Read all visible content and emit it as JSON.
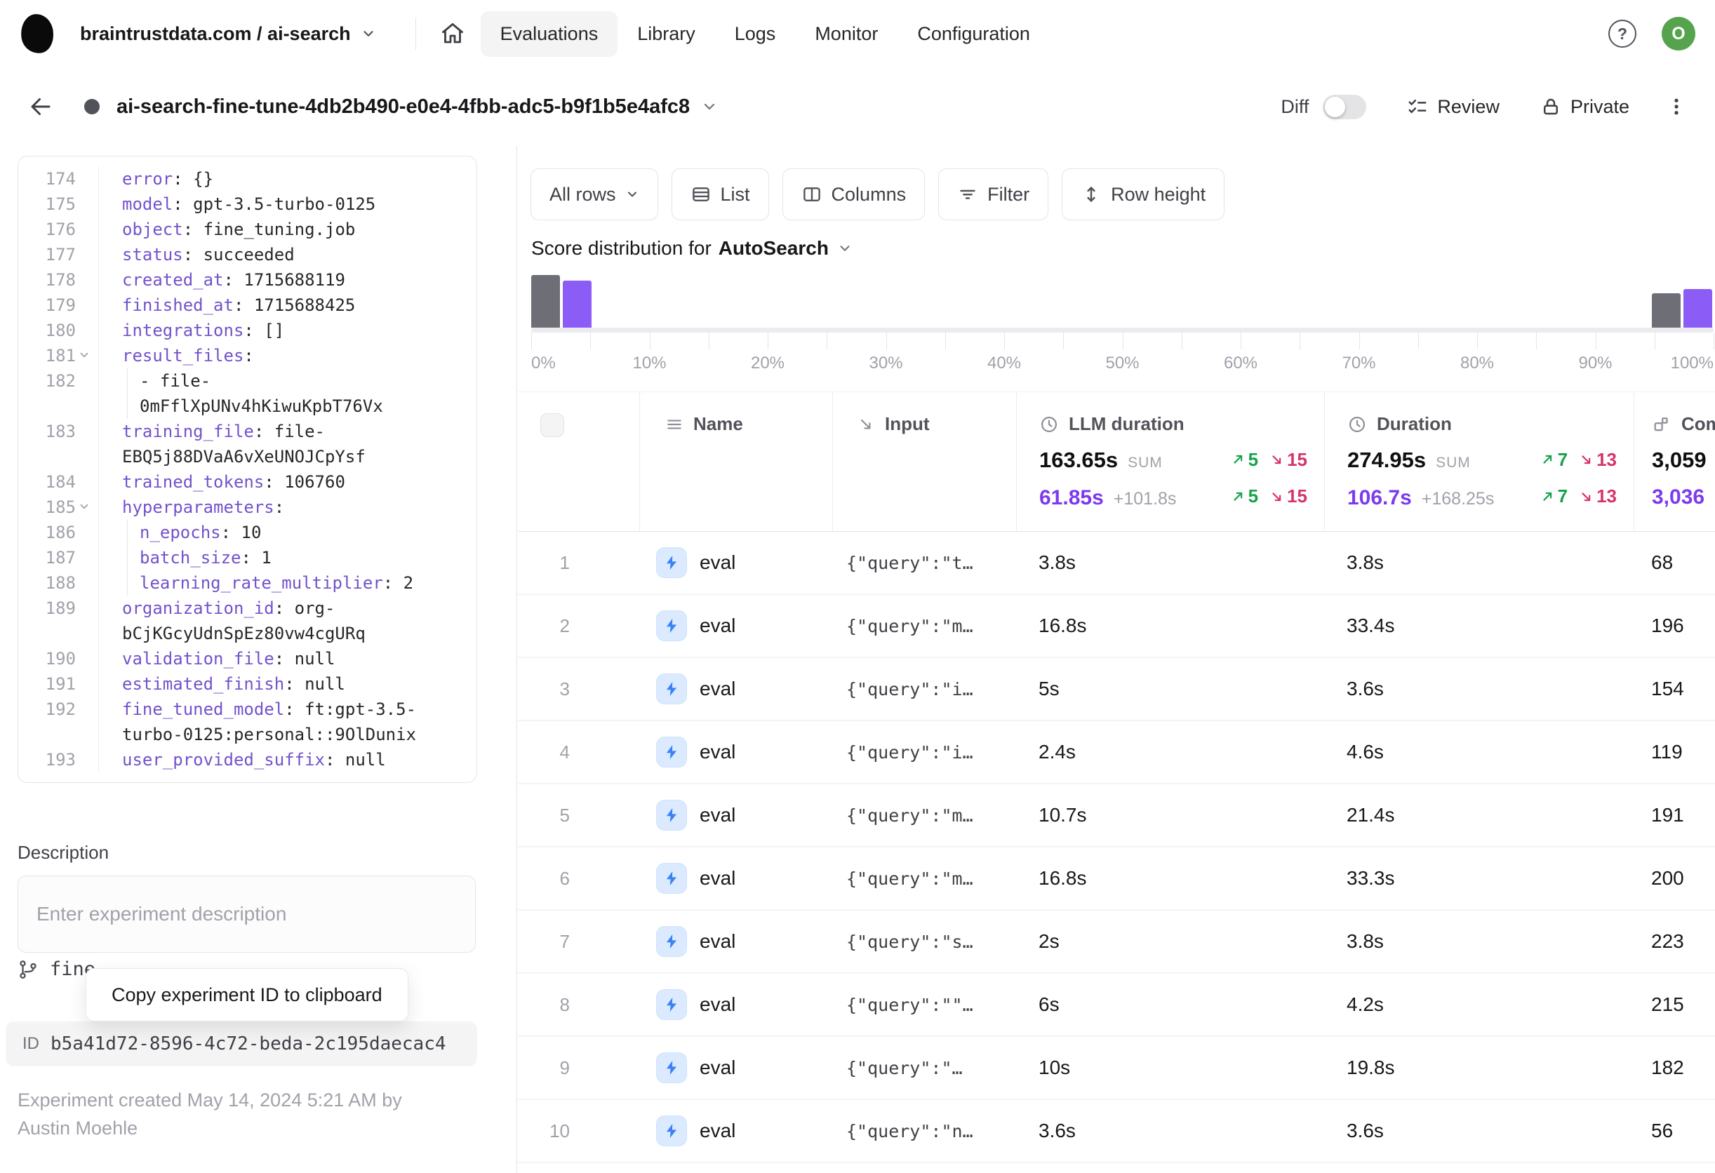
{
  "nav": {
    "breadcrumb": "braintrustdata.com / ai-search",
    "tabs": [
      {
        "label": "Evaluations",
        "active": true
      },
      {
        "label": "Library",
        "active": false
      },
      {
        "label": "Logs",
        "active": false
      },
      {
        "label": "Monitor",
        "active": false
      },
      {
        "label": "Configuration",
        "active": false
      }
    ],
    "avatar_letter": "O"
  },
  "titlebar": {
    "title": "ai-search-fine-tune-4db2b490-e0e4-4fbb-adc5-b9f1b5e4afc8",
    "diff_label": "Diff",
    "review_label": "Review",
    "private_label": "Private"
  },
  "code_panel": {
    "lines": [
      {
        "num": "174",
        "segs": [
          {
            "c": "key",
            "t": "error"
          },
          {
            "c": "t",
            "t": ": {}"
          }
        ]
      },
      {
        "num": "175",
        "segs": [
          {
            "c": "key",
            "t": "model"
          },
          {
            "c": "t",
            "t": ": gpt-3.5-turbo-0125"
          }
        ]
      },
      {
        "num": "176",
        "segs": [
          {
            "c": "key",
            "t": "object"
          },
          {
            "c": "t",
            "t": ": fine_tuning.job"
          }
        ]
      },
      {
        "num": "177",
        "segs": [
          {
            "c": "key",
            "t": "status"
          },
          {
            "c": "t",
            "t": ": succeeded"
          }
        ]
      },
      {
        "num": "178",
        "segs": [
          {
            "c": "key",
            "t": "created_at"
          },
          {
            "c": "t",
            "t": ": 1715688119"
          }
        ]
      },
      {
        "num": "179",
        "segs": [
          {
            "c": "key",
            "t": "finished_at"
          },
          {
            "c": "t",
            "t": ": 1715688425"
          }
        ]
      },
      {
        "num": "180",
        "segs": [
          {
            "c": "key",
            "t": "integrations"
          },
          {
            "c": "t",
            "t": ": []"
          }
        ]
      },
      {
        "num": "181",
        "chevron": true,
        "segs": [
          {
            "c": "key",
            "t": "result_files"
          },
          {
            "c": "t",
            "t": ":"
          }
        ]
      },
      {
        "num": "182",
        "indent": 1,
        "guide": true,
        "segs": [
          {
            "c": "t",
            "t": "- file-\n0mFflXpUNv4hKiwuKpbT76Vx"
          }
        ]
      },
      {
        "num": "183",
        "segs": [
          {
            "c": "key",
            "t": "training_file"
          },
          {
            "c": "t",
            "t": ": file-\nEBQ5j88DVaA6vXeUNOJCpYsf"
          }
        ]
      },
      {
        "num": "184",
        "segs": [
          {
            "c": "key",
            "t": "trained_tokens"
          },
          {
            "c": "t",
            "t": ": 106760"
          }
        ]
      },
      {
        "num": "185",
        "chevron": true,
        "segs": [
          {
            "c": "key",
            "t": "hyperparameters"
          },
          {
            "c": "t",
            "t": ":"
          }
        ]
      },
      {
        "num": "186",
        "indent": 1,
        "guide": true,
        "segs": [
          {
            "c": "key",
            "t": "n_epochs"
          },
          {
            "c": "t",
            "t": ": 10"
          }
        ]
      },
      {
        "num": "187",
        "indent": 1,
        "guide": true,
        "segs": [
          {
            "c": "key",
            "t": "batch_size"
          },
          {
            "c": "t",
            "t": ": 1"
          }
        ]
      },
      {
        "num": "188",
        "indent": 1,
        "guide": true,
        "segs": [
          {
            "c": "key",
            "t": "learning_rate_multiplier"
          },
          {
            "c": "t",
            "t": ": 2"
          }
        ]
      },
      {
        "num": "189",
        "segs": [
          {
            "c": "key",
            "t": "organization_id"
          },
          {
            "c": "t",
            "t": ": org-\nbCjKGcyUdnSpEz80vw4cgURq"
          }
        ]
      },
      {
        "num": "190",
        "segs": [
          {
            "c": "key",
            "t": "validation_file"
          },
          {
            "c": "t",
            "t": ": null"
          }
        ]
      },
      {
        "num": "191",
        "segs": [
          {
            "c": "key",
            "t": "estimated_finish"
          },
          {
            "c": "t",
            "t": ": null"
          }
        ]
      },
      {
        "num": "192",
        "segs": [
          {
            "c": "key",
            "t": "fine_tuned_model"
          },
          {
            "c": "t",
            "t": ": ft:gpt-3.5-\nturbo-0125:personal::9OlDunix"
          }
        ]
      },
      {
        "num": "193",
        "segs": [
          {
            "c": "key",
            "t": "user_provided_suffix"
          },
          {
            "c": "t",
            "t": ": null"
          }
        ]
      }
    ]
  },
  "description": {
    "label": "Description",
    "placeholder": "Enter experiment description"
  },
  "experiment_meta": {
    "branch_text": "fine",
    "tooltip": "Copy experiment ID to clipboard",
    "id_label": "ID",
    "id_value": "b5a41d72-8596-4c72-beda-2c195daecac4",
    "created_note": "Experiment created May 14, 2024 5:21 AM by Austin Moehle"
  },
  "toolbar": {
    "rows_filter": "All rows",
    "list": "List",
    "columns": "Columns",
    "filter": "Filter",
    "row_height": "Row height"
  },
  "score_distribution": {
    "title_prefix": "Score distribution for",
    "score_name": "AutoSearch",
    "type": "histogram",
    "bars": [
      {
        "left": 0,
        "height": 75,
        "color": "#6e6e76",
        "series": "comparison",
        "bucket": "0%"
      },
      {
        "left": 45,
        "height": 67,
        "color": "#8b5cf6",
        "series": "current",
        "bucket": "0%"
      },
      {
        "left": 1597,
        "height": 49,
        "color": "#6e6e76",
        "series": "comparison",
        "bucket": "100%"
      },
      {
        "left": 1642,
        "height": 55,
        "color": "#8b5cf6",
        "series": "current",
        "bucket": "100%"
      }
    ],
    "tick_count": 21,
    "axis_labels": [
      "0%",
      "10%",
      "20%",
      "30%",
      "40%",
      "50%",
      "60%",
      "70%",
      "80%",
      "90%",
      "100%"
    ]
  },
  "table": {
    "name_header": "Name",
    "input_header": "Input",
    "llm": {
      "header": "LLM duration",
      "sum": "163.65s",
      "sum_tag": "SUM",
      "sum_up": "5",
      "sum_down": "15",
      "avg": "61.85s",
      "avg_delta": "+101.8s",
      "avg_up": "5",
      "avg_down": "15"
    },
    "duration": {
      "header": "Duration",
      "sum": "274.95s",
      "sum_tag": "SUM",
      "sum_up": "7",
      "sum_down": "13",
      "avg": "106.7s",
      "avg_delta": "+168.25s",
      "avg_up": "7",
      "avg_down": "13"
    },
    "completion": {
      "header": "Com",
      "sum": "3,059",
      "avg": "3,036"
    },
    "rows": [
      {
        "n": "1",
        "name": "eval",
        "input": "{\"query\":\"t…",
        "llm": "3.8s",
        "dur": "3.8s",
        "com": "68"
      },
      {
        "n": "2",
        "name": "eval",
        "input": "{\"query\":\"m…",
        "llm": "16.8s",
        "dur": "33.4s",
        "com": "196"
      },
      {
        "n": "3",
        "name": "eval",
        "input": "{\"query\":\"i…",
        "llm": "5s",
        "dur": "3.6s",
        "com": "154"
      },
      {
        "n": "4",
        "name": "eval",
        "input": "{\"query\":\"i…",
        "llm": "2.4s",
        "dur": "4.6s",
        "com": "119"
      },
      {
        "n": "5",
        "name": "eval",
        "input": "{\"query\":\"m…",
        "llm": "10.7s",
        "dur": "21.4s",
        "com": "191"
      },
      {
        "n": "6",
        "name": "eval",
        "input": "{\"query\":\"m…",
        "llm": "16.8s",
        "dur": "33.3s",
        "com": "200"
      },
      {
        "n": "7",
        "name": "eval",
        "input": "{\"query\":\"s…",
        "llm": "2s",
        "dur": "3.8s",
        "com": "223"
      },
      {
        "n": "8",
        "name": "eval",
        "input": "{\"query\":\"\"…",
        "llm": "6s",
        "dur": "4.2s",
        "com": "215"
      },
      {
        "n": "9",
        "name": "eval",
        "input": "{\"query\":\"…",
        "llm": "10s",
        "dur": "19.8s",
        "com": "182"
      },
      {
        "n": "10",
        "name": "eval",
        "input": "{\"query\":\"n…",
        "llm": "3.6s",
        "dur": "3.6s",
        "com": "56"
      }
    ]
  },
  "colors": {
    "accent_purple": "#7c3aed",
    "hist_purple": "#8b5cf6",
    "hist_gray": "#6e6e76",
    "green": "#16a34a",
    "red": "#d6336c",
    "eval_blue": "#3b82f6",
    "avatar_green": "#56a34e"
  }
}
